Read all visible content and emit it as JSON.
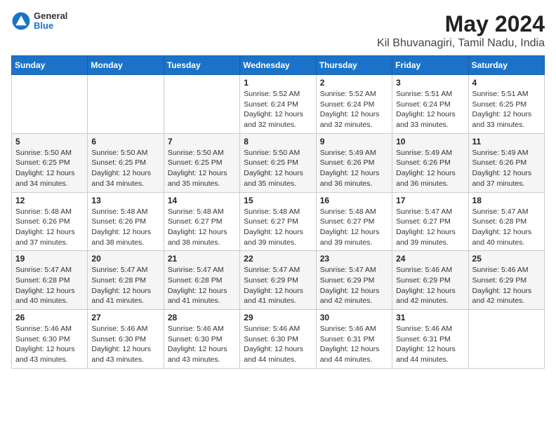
{
  "logo": {
    "line1": "General",
    "line2": "Blue"
  },
  "title": "May 2024",
  "subtitle": "Kil Bhuvanagiri, Tamil Nadu, India",
  "days_of_week": [
    "Sunday",
    "Monday",
    "Tuesday",
    "Wednesday",
    "Thursday",
    "Friday",
    "Saturday"
  ],
  "weeks": [
    [
      {
        "day": "",
        "info": ""
      },
      {
        "day": "",
        "info": ""
      },
      {
        "day": "",
        "info": ""
      },
      {
        "day": "1",
        "info": "Sunrise: 5:52 AM\nSunset: 6:24 PM\nDaylight: 12 hours\nand 32 minutes."
      },
      {
        "day": "2",
        "info": "Sunrise: 5:52 AM\nSunset: 6:24 PM\nDaylight: 12 hours\nand 32 minutes."
      },
      {
        "day": "3",
        "info": "Sunrise: 5:51 AM\nSunset: 6:24 PM\nDaylight: 12 hours\nand 33 minutes."
      },
      {
        "day": "4",
        "info": "Sunrise: 5:51 AM\nSunset: 6:25 PM\nDaylight: 12 hours\nand 33 minutes."
      }
    ],
    [
      {
        "day": "5",
        "info": "Sunrise: 5:50 AM\nSunset: 6:25 PM\nDaylight: 12 hours\nand 34 minutes."
      },
      {
        "day": "6",
        "info": "Sunrise: 5:50 AM\nSunset: 6:25 PM\nDaylight: 12 hours\nand 34 minutes."
      },
      {
        "day": "7",
        "info": "Sunrise: 5:50 AM\nSunset: 6:25 PM\nDaylight: 12 hours\nand 35 minutes."
      },
      {
        "day": "8",
        "info": "Sunrise: 5:50 AM\nSunset: 6:25 PM\nDaylight: 12 hours\nand 35 minutes."
      },
      {
        "day": "9",
        "info": "Sunrise: 5:49 AM\nSunset: 6:26 PM\nDaylight: 12 hours\nand 36 minutes."
      },
      {
        "day": "10",
        "info": "Sunrise: 5:49 AM\nSunset: 6:26 PM\nDaylight: 12 hours\nand 36 minutes."
      },
      {
        "day": "11",
        "info": "Sunrise: 5:49 AM\nSunset: 6:26 PM\nDaylight: 12 hours\nand 37 minutes."
      }
    ],
    [
      {
        "day": "12",
        "info": "Sunrise: 5:48 AM\nSunset: 6:26 PM\nDaylight: 12 hours\nand 37 minutes."
      },
      {
        "day": "13",
        "info": "Sunrise: 5:48 AM\nSunset: 6:26 PM\nDaylight: 12 hours\nand 38 minutes."
      },
      {
        "day": "14",
        "info": "Sunrise: 5:48 AM\nSunset: 6:27 PM\nDaylight: 12 hours\nand 38 minutes."
      },
      {
        "day": "15",
        "info": "Sunrise: 5:48 AM\nSunset: 6:27 PM\nDaylight: 12 hours\nand 39 minutes."
      },
      {
        "day": "16",
        "info": "Sunrise: 5:48 AM\nSunset: 6:27 PM\nDaylight: 12 hours\nand 39 minutes."
      },
      {
        "day": "17",
        "info": "Sunrise: 5:47 AM\nSunset: 6:27 PM\nDaylight: 12 hours\nand 39 minutes."
      },
      {
        "day": "18",
        "info": "Sunrise: 5:47 AM\nSunset: 6:28 PM\nDaylight: 12 hours\nand 40 minutes."
      }
    ],
    [
      {
        "day": "19",
        "info": "Sunrise: 5:47 AM\nSunset: 6:28 PM\nDaylight: 12 hours\nand 40 minutes."
      },
      {
        "day": "20",
        "info": "Sunrise: 5:47 AM\nSunset: 6:28 PM\nDaylight: 12 hours\nand 41 minutes."
      },
      {
        "day": "21",
        "info": "Sunrise: 5:47 AM\nSunset: 6:28 PM\nDaylight: 12 hours\nand 41 minutes."
      },
      {
        "day": "22",
        "info": "Sunrise: 5:47 AM\nSunset: 6:29 PM\nDaylight: 12 hours\nand 41 minutes."
      },
      {
        "day": "23",
        "info": "Sunrise: 5:47 AM\nSunset: 6:29 PM\nDaylight: 12 hours\nand 42 minutes."
      },
      {
        "day": "24",
        "info": "Sunrise: 5:46 AM\nSunset: 6:29 PM\nDaylight: 12 hours\nand 42 minutes."
      },
      {
        "day": "25",
        "info": "Sunrise: 5:46 AM\nSunset: 6:29 PM\nDaylight: 12 hours\nand 42 minutes."
      }
    ],
    [
      {
        "day": "26",
        "info": "Sunrise: 5:46 AM\nSunset: 6:30 PM\nDaylight: 12 hours\nand 43 minutes."
      },
      {
        "day": "27",
        "info": "Sunrise: 5:46 AM\nSunset: 6:30 PM\nDaylight: 12 hours\nand 43 minutes."
      },
      {
        "day": "28",
        "info": "Sunrise: 5:46 AM\nSunset: 6:30 PM\nDaylight: 12 hours\nand 43 minutes."
      },
      {
        "day": "29",
        "info": "Sunrise: 5:46 AM\nSunset: 6:30 PM\nDaylight: 12 hours\nand 44 minutes."
      },
      {
        "day": "30",
        "info": "Sunrise: 5:46 AM\nSunset: 6:31 PM\nDaylight: 12 hours\nand 44 minutes."
      },
      {
        "day": "31",
        "info": "Sunrise: 5:46 AM\nSunset: 6:31 PM\nDaylight: 12 hours\nand 44 minutes."
      },
      {
        "day": "",
        "info": ""
      }
    ]
  ]
}
